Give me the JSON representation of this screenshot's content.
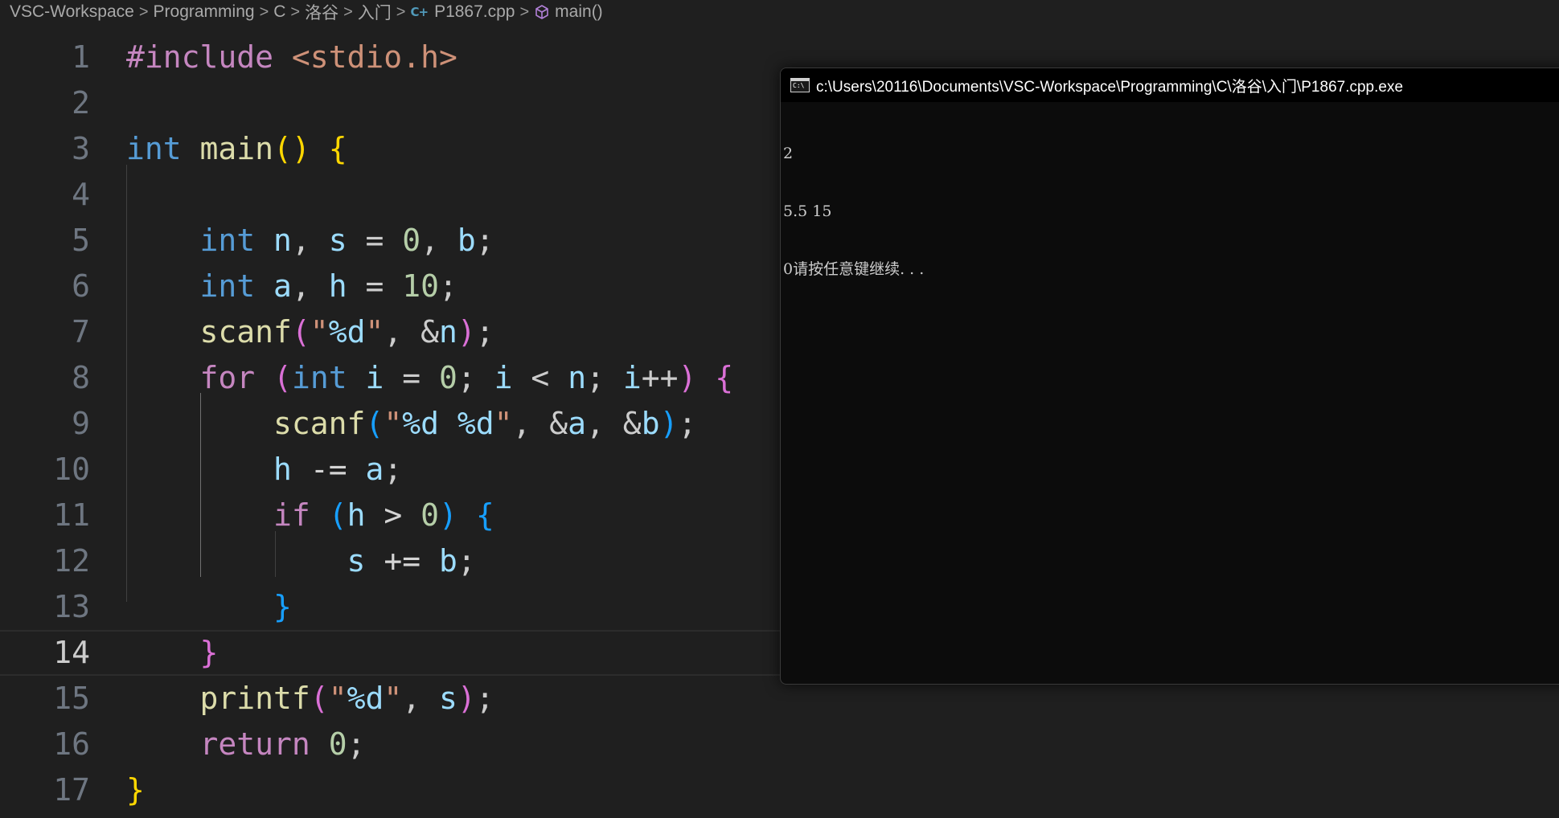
{
  "breadcrumb": {
    "items": [
      "VSC-Workspace",
      "Programming",
      "C",
      "洛谷",
      "入门"
    ],
    "file_icon_text": "C+",
    "file": "P1867.cpp",
    "symbol": "main()",
    "separator": ">"
  },
  "editor": {
    "active_line": 14,
    "line_numbers": [
      "1",
      "2",
      "3",
      "4",
      "5",
      "6",
      "7",
      "8",
      "9",
      "10",
      "11",
      "12",
      "13",
      "14",
      "15",
      "16",
      "17"
    ],
    "code": {
      "l1": {
        "directive": "#include",
        "header": "<stdio.h>"
      },
      "l3": {
        "type": "int",
        "fn": "main",
        "lparen": "(",
        "rparen": ")",
        "brace": "{"
      },
      "l5": {
        "type": "int",
        "v1": "n",
        "v2": "s",
        "n0": "0",
        "v3": "b"
      },
      "l6": {
        "type": "int",
        "v1": "a",
        "v2": "h",
        "n10": "10"
      },
      "l7": {
        "fn": "scanf",
        "lparen": "(",
        "str_q1": "\"",
        "fmt": "%d",
        "str_q2": "\"",
        "v": "n",
        "rparen": ")"
      },
      "l8": {
        "kw": "for",
        "lparen": "(",
        "type": "int",
        "i1": "i",
        "n0": "0",
        "i2": "i",
        "v": "n",
        "i3": "i",
        "rparen": ")",
        "brace": "{"
      },
      "l9": {
        "fn": "scanf",
        "lparen": "(",
        "str_q1": "\"",
        "fmt1": "%d",
        "sp": " ",
        "fmt2": "%d",
        "str_q2": "\"",
        "v1": "a",
        "v2": "b",
        "rparen": ")"
      },
      "l10": {
        "v1": "h",
        "op": "-=",
        "v2": "a"
      },
      "l11": {
        "kw": "if",
        "lparen": "(",
        "v": "h",
        "op": ">",
        "n0": "0",
        "rparen": ")",
        "brace": "{"
      },
      "l12": {
        "v1": "s",
        "op": "+=",
        "v2": "b"
      },
      "l13": {
        "brace": "}"
      },
      "l14": {
        "brace": "}"
      },
      "l15": {
        "fn": "printf",
        "lparen": "(",
        "str_q1": "\"",
        "fmt": "%d",
        "str_q2": "\"",
        "v": "s",
        "rparen": ")"
      },
      "l16": {
        "kw": "return",
        "n0": "0"
      },
      "l17": {
        "brace": "}"
      }
    }
  },
  "console": {
    "icon_text": "C:\\",
    "title": "c:\\Users\\20116\\Documents\\VSC-Workspace\\Programming\\C\\洛谷\\入门\\P1867.cpp.exe",
    "output_lines": [
      "2",
      "5.5 15",
      "0请按任意键继续. . ."
    ]
  },
  "colors": {
    "editor_bg": "#1f1f1f",
    "console_bg": "#0c0c0c",
    "keyword": "#569cd6",
    "control": "#c586c0",
    "function": "#dcdcaa",
    "variable": "#9cdcfe",
    "number": "#b5cea8",
    "string": "#ce9178",
    "bracket_1": "#ffd700",
    "bracket_2": "#da70d6",
    "bracket_3": "#179fff"
  }
}
